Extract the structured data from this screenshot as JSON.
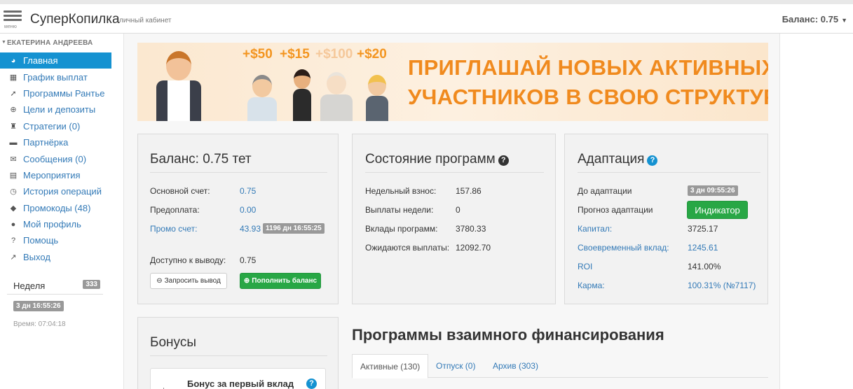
{
  "header": {
    "menu_label": "меню",
    "brand": "СуперКопилка",
    "brand_sub": "личный кабинет",
    "balance": "Баланс: 0.75"
  },
  "sidebar": {
    "user": "ЕКАТЕРИНА АНДРЕЕВА",
    "items": [
      {
        "label": "Главная",
        "icon": "dashboard-icon",
        "glyph": "◕"
      },
      {
        "label": "График выплат",
        "icon": "calendar-icon",
        "glyph": "▦"
      },
      {
        "label": "Программы Рантье",
        "icon": "rocket-icon",
        "glyph": "➚"
      },
      {
        "label": "Цели и депозиты",
        "icon": "crosshairs-icon",
        "glyph": "⊕"
      },
      {
        "label": "Стратегии (0)",
        "icon": "chess-icon",
        "glyph": "♜"
      },
      {
        "label": "Партнёрка",
        "icon": "briefcase-icon",
        "glyph": "▬"
      },
      {
        "label": "Сообщения (0)",
        "icon": "comments-icon",
        "glyph": "✉"
      },
      {
        "label": "Мероприятия",
        "icon": "film-icon",
        "glyph": "▤"
      },
      {
        "label": "История операций",
        "icon": "clock-icon",
        "glyph": "◷"
      },
      {
        "label": "Промокоды (48)",
        "icon": "tag-icon",
        "glyph": "◆"
      },
      {
        "label": "Мой профиль",
        "icon": "user-icon",
        "glyph": "●"
      },
      {
        "label": "Помощь",
        "icon": "question-icon",
        "glyph": "?"
      },
      {
        "label": "Выход",
        "icon": "sign-out-icon",
        "glyph": "↗"
      }
    ],
    "week_label": "Неделя",
    "week_count": "333",
    "week_timer": "3 дн 16:55:26",
    "time": "Время: 07:04:18"
  },
  "banner": {
    "bonuses": [
      "+$50",
      "+$15",
      "+$100",
      "+$20"
    ],
    "line1": "ПРИГЛАШАЙ НОВЫХ АКТИВНЫХ",
    "line2": "УЧАСТНИКОВ В СВОЮ СТРУКТУРУ"
  },
  "balance_panel": {
    "title": "Баланс: 0.75 тет",
    "main_label": "Основной счет:",
    "main_value": "0.75",
    "prepay_label": "Предоплата:",
    "prepay_value": "0.00",
    "promo_label": "Промо счет:",
    "promo_value": "43.93",
    "promo_timer": "1196 дн 16:55:25",
    "available_label": "Доступно к выводу:",
    "available_value": "0.75",
    "withdraw_button": "Запросить вывод",
    "topup_button": "Пополнить баланс"
  },
  "programs_panel": {
    "title": "Состояние программ",
    "rows": [
      {
        "label": "Недельный взнос:",
        "value": "157.86"
      },
      {
        "label": "Выплаты недели:",
        "value": "0"
      },
      {
        "label": "Вклады программ:",
        "value": "3780.33"
      },
      {
        "label": "Ожидаются выплаты:",
        "value": "12092.70"
      }
    ]
  },
  "adaptation_panel": {
    "title": "Адаптация",
    "before_label": "До адаптации",
    "before_timer": "3 дн 09:55:26",
    "forecast_label": "Прогноз адаптации",
    "indicator_button": "Индикатор",
    "capital_label": "Капитал:",
    "capital_value": "3725.17",
    "timely_label": "Своевременный вклад:",
    "timely_value": "1245.61",
    "roi_label": "ROI",
    "roi_value": "141.00%",
    "karma_label": "Карма:",
    "karma_value": "100.31%",
    "karma_rank": "(№7117)"
  },
  "bonuses_panel": {
    "title": "Бонусы",
    "first_bonus": "Бонус за первый вклад"
  },
  "mutual": {
    "title": "Программы взаимного финансирования",
    "tabs": [
      "Активные (130)",
      "Отпуск (0)",
      "Архив (303)"
    ]
  }
}
